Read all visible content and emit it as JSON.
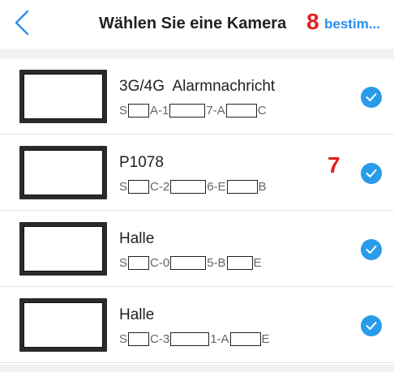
{
  "header": {
    "back_icon": "chevron-left-icon",
    "title": "Wählen Sie eine Kamera",
    "title_mark": "8",
    "action_label": "bestim..."
  },
  "colors": {
    "accent": "#2a8ff0",
    "check": "#2a9bea",
    "annotation": "#e31e1e"
  },
  "cameras": [
    {
      "name": "3G/4G  Alarmnachricht",
      "serial_parts": [
        "S",
        "A-1",
        "7-A",
        "C"
      ],
      "selected": true,
      "mark": ""
    },
    {
      "name": "P1078",
      "serial_parts": [
        "S",
        "C-2",
        "6-E",
        "B"
      ],
      "selected": true,
      "mark": "7"
    },
    {
      "name": "Halle",
      "serial_parts": [
        "S",
        "C-0",
        "5-B",
        "E"
      ],
      "selected": true,
      "mark": ""
    },
    {
      "name": "Halle",
      "serial_parts": [
        "S",
        "C-3",
        "1-A",
        "E"
      ],
      "selected": true,
      "mark": ""
    }
  ]
}
